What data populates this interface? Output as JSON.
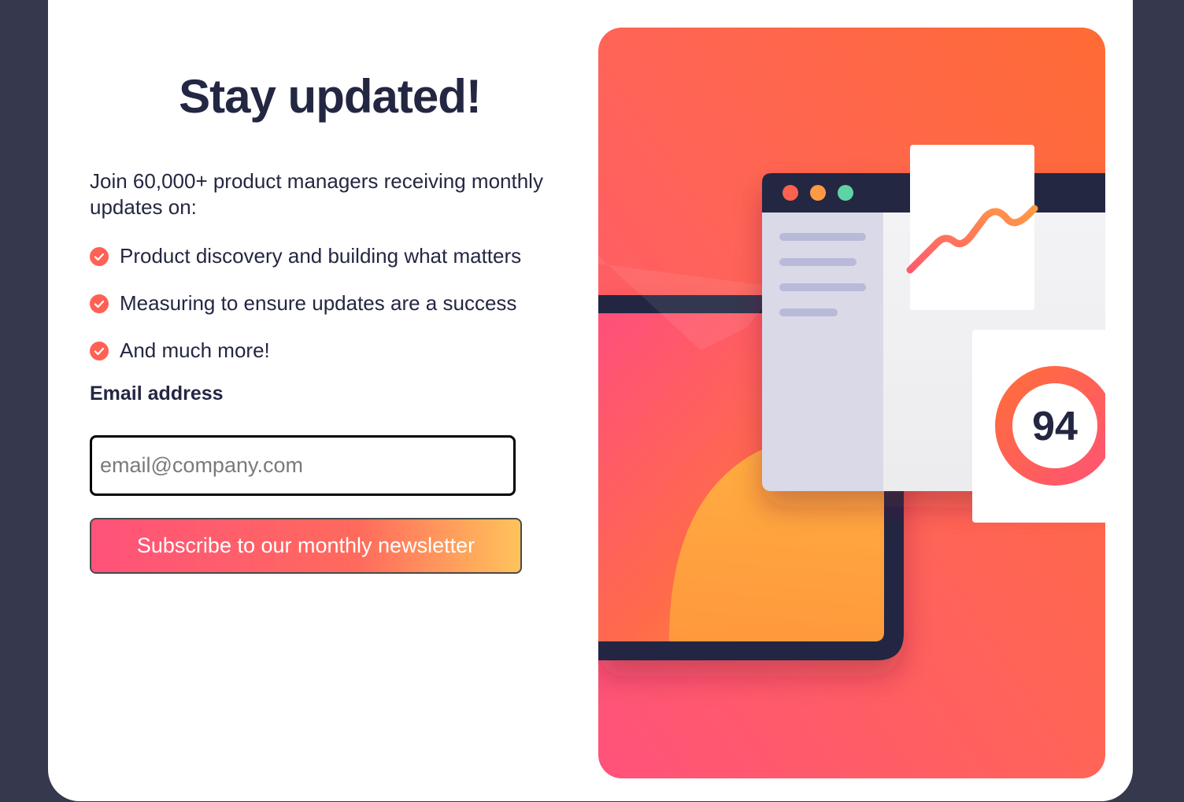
{
  "title": "Stay updated!",
  "intro": "Join 60,000+ product managers receiving monthly updates on:",
  "features": [
    "Product discovery and building what matters",
    "Measuring to ensure updates are a success",
    "And much more!"
  ],
  "form": {
    "email_label": "Email address",
    "email_placeholder": "email@company.com",
    "email_value": "",
    "subscribe_label": "Subscribe to our monthly newsletter"
  },
  "illustration": {
    "score": "94"
  },
  "icons": {
    "feature_bullet": "check-circle-icon",
    "window_dots": [
      "window-dot-red",
      "window-dot-orange",
      "window-dot-green"
    ]
  },
  "colors": {
    "background": "#36384d",
    "card": "#ffffff",
    "text_dark": "#242742",
    "accent": "#ff6155",
    "gradient_pink": "#ff527b",
    "gradient_orange": "#ff6a3a",
    "gradient_yellow": "#ffc35b"
  }
}
